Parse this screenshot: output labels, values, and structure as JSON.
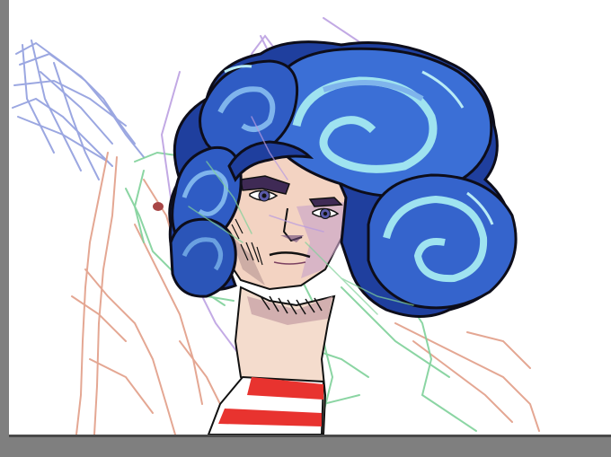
{
  "canvas": {
    "background": "#ffffff",
    "workspace_color": "#7f7f7f"
  },
  "artwork": {
    "subject": "character-bust-illustration",
    "palette": {
      "hair_dark": "#1f3f9e",
      "hair_mid": "#3b6fd6",
      "hair_light": "#7fb4ec",
      "hair_highlight": "#9fe3f0",
      "skin": "#f3d3c2",
      "skin_shade": "#c9a4a8",
      "shirt_stripe_red": "#e8332f",
      "outline": "#111111",
      "sketch_blue": "#8090d8",
      "sketch_green": "#7fd39a",
      "sketch_salmon": "#e0a08c",
      "sketch_purple": "#b69ad8",
      "blush_mark": "#b04a4a"
    }
  }
}
